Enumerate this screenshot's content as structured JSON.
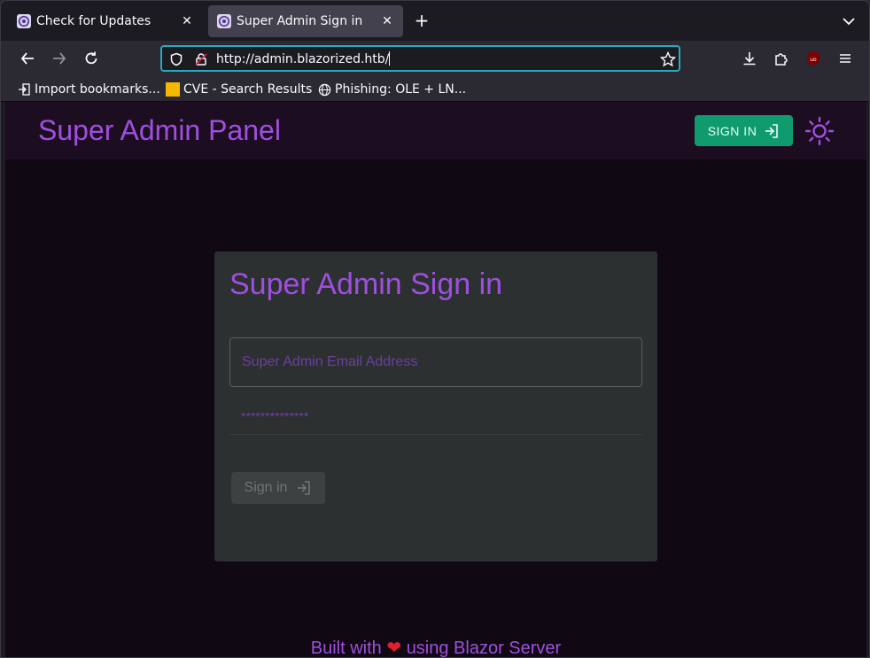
{
  "browser": {
    "tabs": [
      {
        "label": "Check for Updates",
        "active": false
      },
      {
        "label": "Super Admin Sign in",
        "active": true
      }
    ],
    "url": "http://admin.blazorized.htb/",
    "bookmarks": [
      {
        "label": "Import bookmarks...",
        "icon": "import-icon"
      },
      {
        "label": "CVE - Search Results",
        "icon": "folder-icon"
      },
      {
        "label": "Phishing: OLE + LN...",
        "icon": "globe-icon"
      }
    ]
  },
  "app": {
    "title": "Super Admin Panel",
    "signin_label": "SIGN IN",
    "accent": "#9f4fe0",
    "success": "#0f9b6e"
  },
  "login": {
    "title": "Super Admin Sign in",
    "email_placeholder": "Super Admin Email Address",
    "password_placeholder": "**************",
    "submit_label": "Sign in"
  },
  "footer": {
    "prefix": "Built with",
    "heart": "❤",
    "suffix": "using Blazor Server"
  }
}
